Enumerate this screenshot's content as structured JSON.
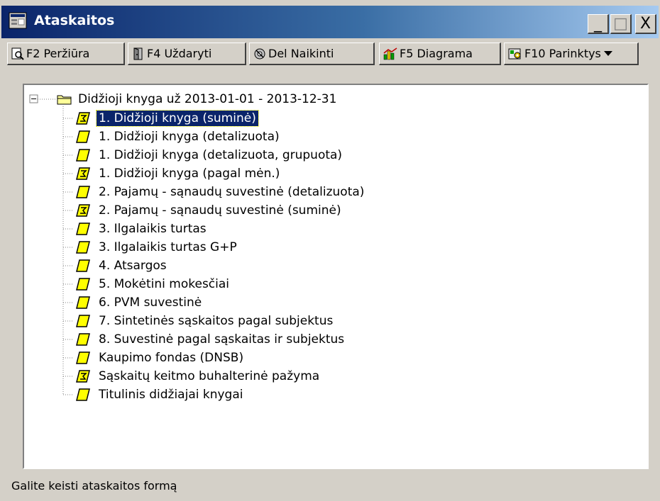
{
  "window": {
    "title": "Ataskaitos"
  },
  "caption_buttons": {
    "minimize": "_",
    "maximize": "□",
    "close": "X"
  },
  "toolbar": {
    "preview": "F2 Peržiūra",
    "close": "F4 Uždaryti",
    "delete": "Del Naikinti",
    "diagram": "F5 Diagrama",
    "options": "F10 Parinktys"
  },
  "tree": {
    "root": "Didžioji knyga už 2013-01-01 - 2013-12-31",
    "items": [
      {
        "label": "1. Didžioji knyga  (suminė)",
        "icon": "summary-report-icon",
        "selected": true
      },
      {
        "label": "1. Didžioji knyga (detalizuota)",
        "icon": "report-icon"
      },
      {
        "label": "1. Didžioji knyga (detalizuota, grupuota)",
        "icon": "report-icon"
      },
      {
        "label": "1. Didžioji knyga (pagal mėn.)",
        "icon": "summary-report-icon"
      },
      {
        "label": "2. Pajamų - sąnaudų suvestinė (detalizuota)",
        "icon": "report-icon"
      },
      {
        "label": "2. Pajamų - sąnaudų suvestinė (suminė)",
        "icon": "summary-report-icon"
      },
      {
        "label": "3. Ilgalaikis turtas",
        "icon": "report-icon"
      },
      {
        "label": "3. Ilgalaikis turtas G+P",
        "icon": "report-icon"
      },
      {
        "label": "4. Atsargos",
        "icon": "report-icon"
      },
      {
        "label": "5. Mokėtini mokesčiai",
        "icon": "report-icon"
      },
      {
        "label": "6. PVM suvestinė",
        "icon": "report-icon"
      },
      {
        "label": "7. Sintetinės sąskaitos pagal subjektus",
        "icon": "report-icon"
      },
      {
        "label": "8. Suvestinė pagal sąskaitas ir subjektus",
        "icon": "report-icon"
      },
      {
        "label": "Kaupimo fondas (DNSB)",
        "icon": "report-icon"
      },
      {
        "label": "Sąskaitų keitmo buhalterinė pažyma",
        "icon": "summary-report-icon"
      },
      {
        "label": "Titulinis didžiajai knygai",
        "icon": "report-icon"
      }
    ]
  },
  "status": {
    "text": "Galite keisti ataskaitos formą"
  }
}
